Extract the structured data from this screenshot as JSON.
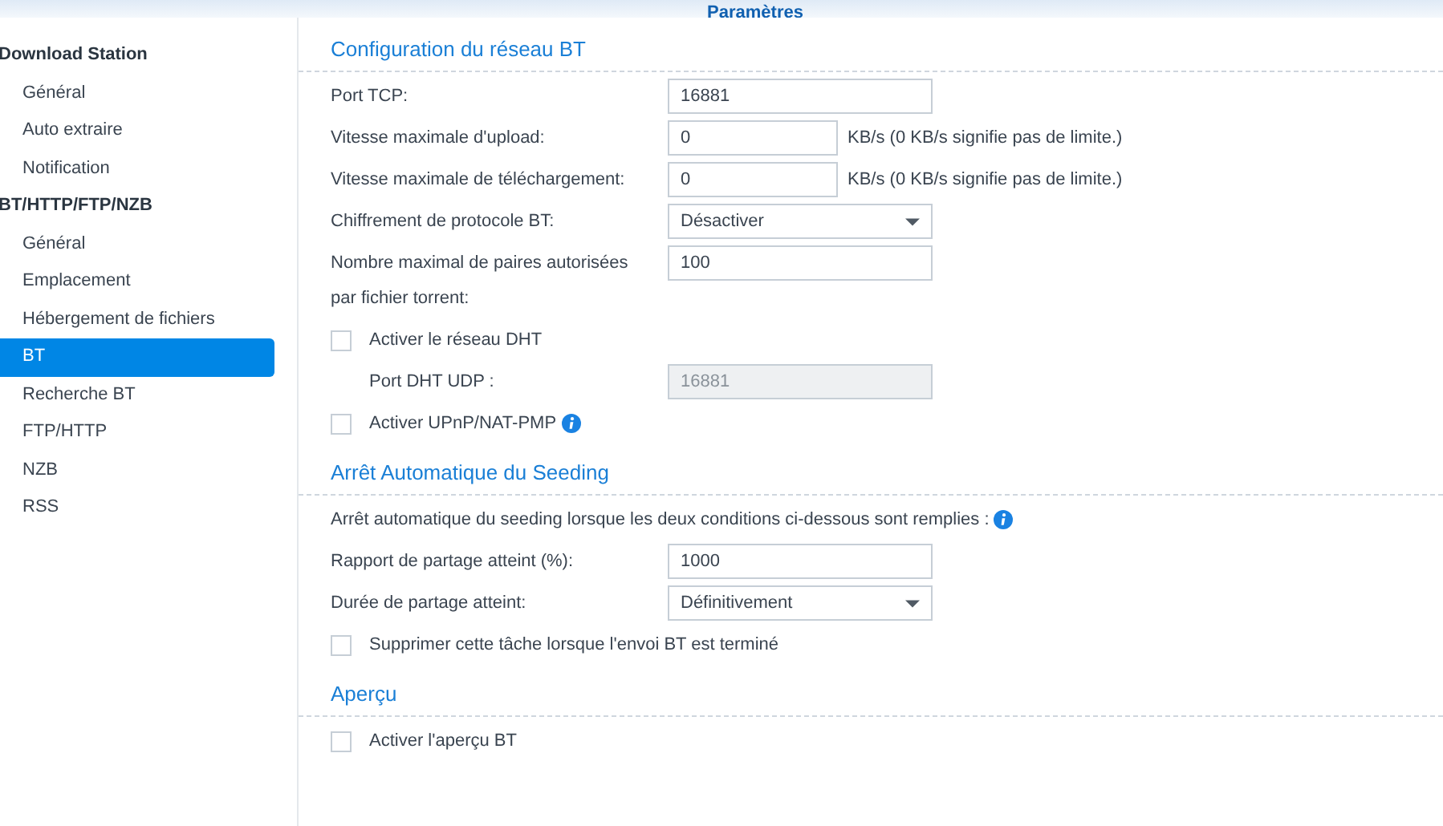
{
  "window": {
    "title": "Paramètres"
  },
  "sidebar": {
    "groups": [
      {
        "heading": "Download Station",
        "items": [
          {
            "label": "Général",
            "selected": false
          },
          {
            "label": "Auto extraire",
            "selected": false
          },
          {
            "label": "Notification",
            "selected": false
          }
        ]
      },
      {
        "heading": "BT/HTTP/FTP/NZB",
        "items": [
          {
            "label": "Général",
            "selected": false
          },
          {
            "label": "Emplacement",
            "selected": false
          },
          {
            "label": "Hébergement de fichiers",
            "selected": false
          },
          {
            "label": "BT",
            "selected": true
          },
          {
            "label": "Recherche BT",
            "selected": false
          },
          {
            "label": "FTP/HTTP",
            "selected": false
          },
          {
            "label": "NZB",
            "selected": false
          },
          {
            "label": "RSS",
            "selected": false
          }
        ]
      }
    ]
  },
  "sections": [
    {
      "title": "Configuration du réseau BT",
      "rows": [
        {
          "kind": "input",
          "label": "Port TCP:",
          "value": "16881"
        },
        {
          "kind": "input",
          "label": "Vitesse maximale d'upload:",
          "value": "0",
          "unit": "KB/s (0 KB/s signifie pas de limite.)"
        },
        {
          "kind": "input",
          "label": "Vitesse maximale de téléchargement:",
          "value": "0",
          "unit": "KB/s (0 KB/s signifie pas de limite.)"
        },
        {
          "kind": "select",
          "label": "Chiffrement de protocole BT:",
          "value": "Désactiver"
        },
        {
          "kind": "input",
          "label": "Nombre maximal de paires autorisées par fichier torrent:",
          "value": "100"
        },
        {
          "kind": "checkbox",
          "label": "Activer le réseau DHT",
          "checked": false
        },
        {
          "kind": "input",
          "label": "Port DHT UDP :",
          "value": "16881",
          "disabled": true,
          "indent": true
        },
        {
          "kind": "checkbox",
          "label": "Activer UPnP/NAT-PMP",
          "checked": false,
          "info": true
        }
      ]
    },
    {
      "title": "Arrêt Automatique du Seeding",
      "rows": [
        {
          "kind": "text",
          "label": "Arrêt automatique du seeding lorsque les deux conditions ci-dessous sont remplies :",
          "info": true
        },
        {
          "kind": "input",
          "label": "Rapport de partage atteint (%):",
          "value": "1000"
        },
        {
          "kind": "select",
          "label": "Durée de partage atteint:",
          "value": "Définitivement"
        },
        {
          "kind": "checkbox",
          "label": "Supprimer cette tâche lorsque l'envoi BT est terminé",
          "checked": false
        }
      ]
    },
    {
      "title": "Aperçu",
      "rows": [
        {
          "kind": "checkbox",
          "label": "Activer l'aperçu BT",
          "checked": false
        }
      ]
    }
  ]
}
